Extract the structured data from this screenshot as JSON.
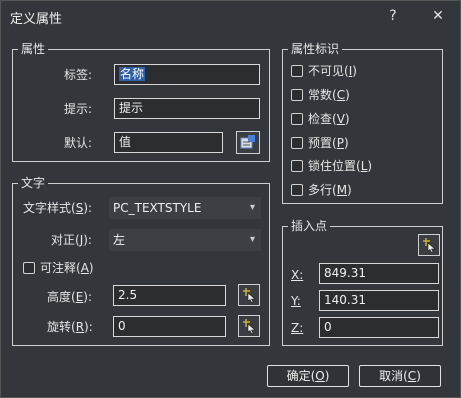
{
  "window": {
    "title": "定义属性",
    "help_glyph": "?",
    "close_glyph": "✕"
  },
  "attribute": {
    "legend": "属性",
    "tag_label": "标签:",
    "tag_value": "名称",
    "prompt_label": "提示:",
    "prompt_value": "提示",
    "default_label": "默认:",
    "default_value": "值"
  },
  "attr_flags": {
    "legend": "属性标识",
    "items": [
      {
        "text": "不可见(",
        "key": "I",
        "close": ")",
        "checked": false
      },
      {
        "text": "常数(",
        "key": "C",
        "close": ")",
        "checked": false
      },
      {
        "text": "检查(",
        "key": "V",
        "close": ")",
        "checked": false
      },
      {
        "text": "预置(",
        "key": "P",
        "close": ")",
        "checked": false
      },
      {
        "text": "锁住位置(",
        "key": "L",
        "close": ")",
        "checked": false
      },
      {
        "text": "多行(",
        "key": "M",
        "close": ")",
        "checked": false
      }
    ]
  },
  "text": {
    "legend": "文字",
    "style_label_pre": "文字样式(",
    "style_label_key": "S",
    "style_label_post": "):",
    "style_value": "PC_TEXTSTYLE",
    "justify_label_pre": "对正(",
    "justify_label_key": "J",
    "justify_label_post": "):",
    "justify_value": "左",
    "annotative_pre": "可注释(",
    "annotative_key": "A",
    "annotative_post": ")",
    "annotative_checked": false,
    "height_label_pre": "高度(",
    "height_label_key": "E",
    "height_label_post": "):",
    "height_value": "2.5",
    "rotation_label_pre": "旋转(",
    "rotation_label_key": "R",
    "rotation_label_post": "):",
    "rotation_value": "0"
  },
  "insert": {
    "legend": "插入点",
    "x_label": "X:",
    "x_value": "849.31",
    "y_label": "Y:",
    "y_value": "140.31",
    "z_label": "Z:",
    "z_value": "0"
  },
  "buttons": {
    "ok_pre": "确定(",
    "ok_key": "O",
    "ok_post": ")",
    "cancel_pre": "取消(",
    "cancel_key": "C",
    "cancel_post": ")"
  }
}
